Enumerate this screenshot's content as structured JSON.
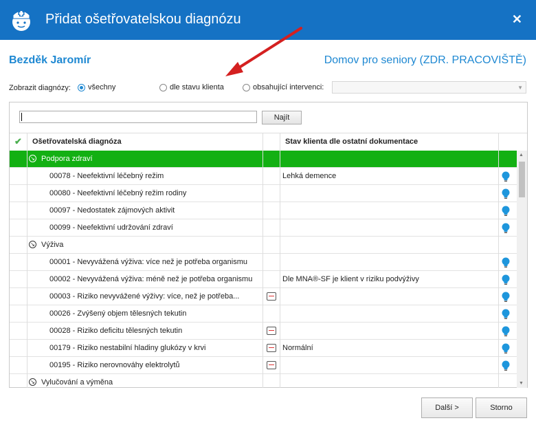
{
  "window": {
    "title": "Přidat ošetřovatelskou diagnózu",
    "close_glyph": "✕"
  },
  "header": {
    "client_name": "Bezděk Jaromír",
    "facility": "Domov pro seniory (ZDR. PRACOVIŠTĚ)"
  },
  "filter": {
    "label": "Zobrazit diagnózy:",
    "options": [
      {
        "label": "všechny",
        "selected": true
      },
      {
        "label": "dle stavu klienta",
        "selected": false
      },
      {
        "label": "obsahující intervenci:",
        "selected": false
      }
    ],
    "intervention_value": ""
  },
  "search": {
    "value": "",
    "button_label": "Najít"
  },
  "table": {
    "columns": {
      "check": "✔",
      "diagnosis": "Ošetřovatelská diagnóza",
      "status": "Stav klienta dle ostatní dokumentace"
    },
    "rows": [
      {
        "type": "group",
        "label": "Podpora zdraví",
        "highlighted": true
      },
      {
        "type": "item",
        "label": "00078 - Neefektivní léčebný režim",
        "status": "Lehká demence",
        "monitor": false
      },
      {
        "type": "item",
        "label": "00080 - Neefektivní léčebný režim rodiny",
        "status": "",
        "monitor": false
      },
      {
        "type": "item",
        "label": "00097 - Nedostatek zájmových aktivit",
        "status": "",
        "monitor": false
      },
      {
        "type": "item",
        "label": "00099 - Neefektivní udržování zdraví",
        "status": "",
        "monitor": false
      },
      {
        "type": "group",
        "label": "Výživa",
        "highlighted": false
      },
      {
        "type": "item",
        "label": "00001 - Nevyvážená výživa: více než je potřeba organismu",
        "status": "",
        "monitor": false
      },
      {
        "type": "item",
        "label": "00002 - Nevyvážená výživa: méně než je potřeba organismu",
        "status": "Dle MNA®-SF je klient v riziku podvýživy",
        "monitor": false
      },
      {
        "type": "item",
        "label": "00003 - Riziko nevyvážené výživy: více, než je potřeba...",
        "status": "",
        "monitor": true
      },
      {
        "type": "item",
        "label": "00026 - Zvýšený objem tělesných tekutin",
        "status": "",
        "monitor": false
      },
      {
        "type": "item",
        "label": "00028 - Riziko deficitu tělesných tekutin",
        "status": "",
        "monitor": true
      },
      {
        "type": "item",
        "label": "00179 - Riziko nestabilní hladiny glukózy v krvi",
        "status": "Normální",
        "monitor": true
      },
      {
        "type": "item",
        "label": "00195 - Riziko nerovnováhy elektrolytů",
        "status": "",
        "monitor": true
      },
      {
        "type": "group",
        "label": "Vylučování a výměna",
        "highlighted": false
      }
    ]
  },
  "buttons": {
    "next": "Další >",
    "cancel": "Storno"
  },
  "colors": {
    "titlebar": "#1572c4",
    "accent": "#1e88d2",
    "group_highlight": "#13b013",
    "bulb": "#1e96dc",
    "annotation_arrow": "#d42020"
  },
  "icons": {
    "app": "nurse-icon",
    "bulb": "lightbulb-icon",
    "group": "expand-circle-icon",
    "monitor": "monitor-icon",
    "check": "check-icon"
  }
}
